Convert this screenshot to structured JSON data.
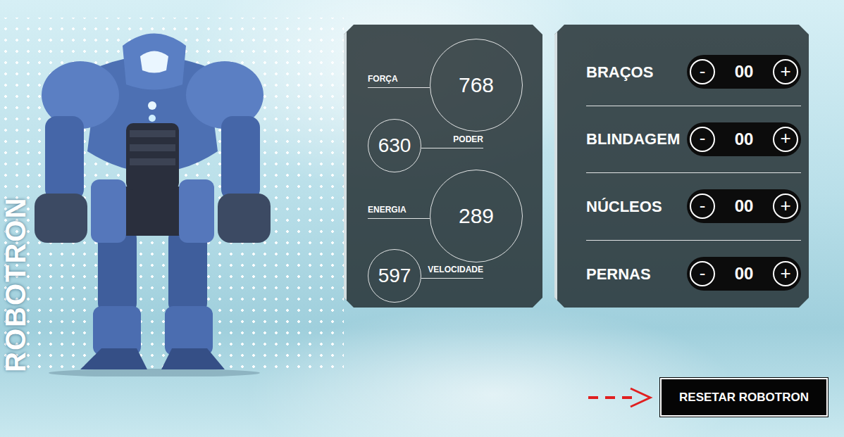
{
  "title": "ROBOTRON",
  "stats": [
    {
      "label": "FORÇA",
      "value": "768",
      "kind": "big"
    },
    {
      "label": "PODER",
      "value": "630",
      "kind": "small"
    },
    {
      "label": "ENERGIA",
      "value": "289",
      "kind": "big"
    },
    {
      "label": "VELOCIDADE",
      "value": "597",
      "kind": "small"
    }
  ],
  "parts": [
    {
      "label": "BRAÇOS",
      "minus": "-",
      "count": "00",
      "plus": "+"
    },
    {
      "label": "BLINDAGEM",
      "minus": "-",
      "count": "00",
      "plus": "+"
    },
    {
      "label": "NÚCLEOS",
      "minus": "-",
      "count": "00",
      "plus": "+"
    },
    {
      "label": "PERNAS",
      "minus": "-",
      "count": "00",
      "plus": "+"
    }
  ],
  "reset_button": {
    "label": "RESETAR ROBOTRON"
  }
}
